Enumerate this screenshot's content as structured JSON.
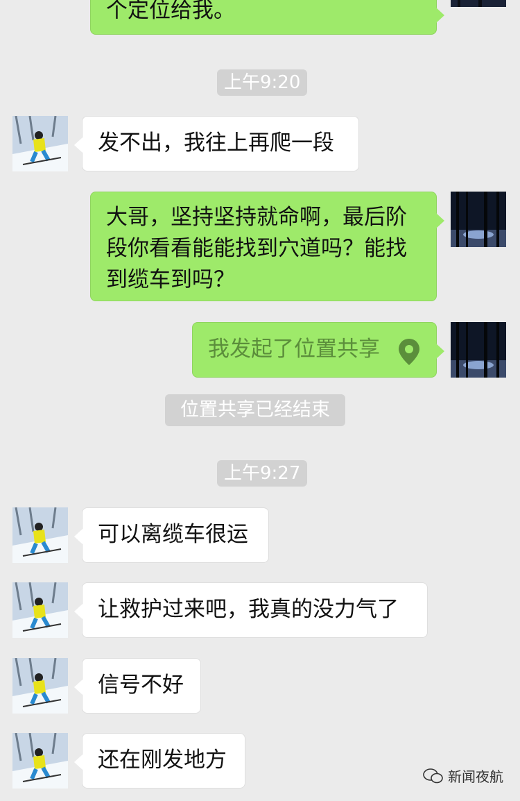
{
  "messages": {
    "m0_partial": "个定位给我。",
    "time1": "上午9:20",
    "m1": "发不出，我往上再爬一段",
    "m2_line1": "大哥，坚持坚持就命啊，最后阶",
    "m2_line2": "段你看看能能找到穴道吗？能找",
    "m2_line3": "到缆车到吗？",
    "m3": "我发起了位置共享",
    "system_note": "位置共享已经结束",
    "time2": "上午9:27",
    "m4": "可以离缆车很运",
    "m5": "让救护过来吧，我真的没力气了",
    "m6": "信号不好",
    "m7": "还在刚发地方"
  },
  "watermark": {
    "text": "新闻夜航"
  },
  "colors": {
    "background": "#ebebeb",
    "bubble_sent": "#9eea6a",
    "bubble_received": "#ffffff",
    "time_pill": "#d2d2d2",
    "location_icon": "#5b8e3b"
  }
}
